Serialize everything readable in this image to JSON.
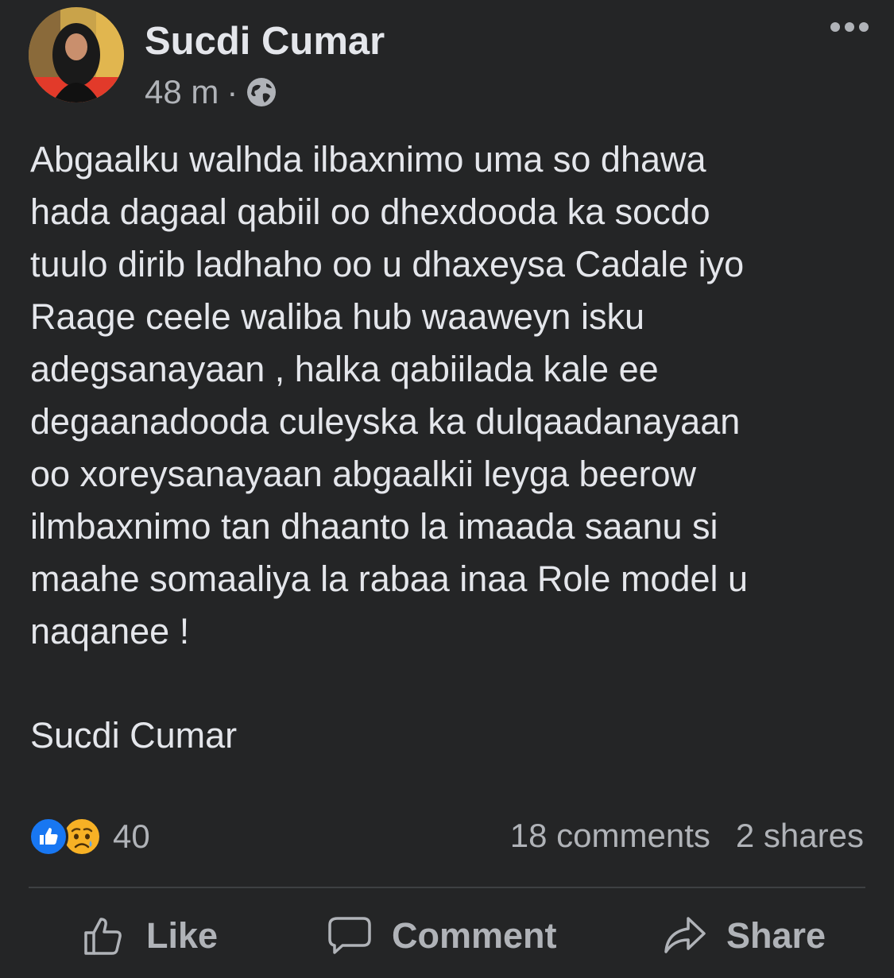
{
  "post": {
    "author": "Sucdi Cumar",
    "time": "48 m",
    "separator": "·",
    "privacy_icon": "globe-icon",
    "body_lines": [
      "Abgaalku walhda ilbaxnimo uma so dhawa",
      "hada dagaal qabiil oo dhexdooda ka socdo",
      "tuulo dirib ladhaho oo u dhaxeysa Cadale iyo",
      "Raage ceele waliba hub waaweyn isku",
      "adegsanayaan , halka qabiilada kale ee",
      "degaanadooda culeyska ka dulqaadanayaan",
      "oo xoreysanayaan abgaalkii leyga beerow",
      "ilmbaxnimo tan dhaanto la imaada saanu si",
      "maahe somaaliya la rabaa inaa Role model u",
      "naqanee !"
    ],
    "signature": "Sucdi Cumar"
  },
  "stats": {
    "reaction_icons": [
      "like-icon",
      "sad-icon"
    ],
    "reaction_count": "40",
    "comments": "18 comments",
    "shares": "2 shares"
  },
  "actions": {
    "like": "Like",
    "comment": "Comment",
    "share": "Share"
  },
  "colors": {
    "background": "#242526",
    "text_primary": "#e4e6eb",
    "text_secondary": "#b0b3b8",
    "like_blue": "#1877f2",
    "divider": "#3e4042"
  }
}
